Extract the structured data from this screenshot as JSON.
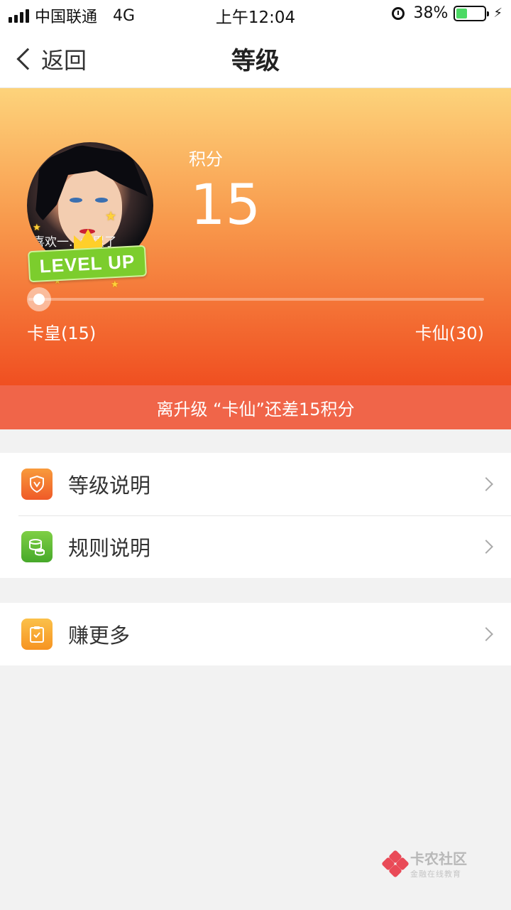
{
  "status_bar": {
    "carrier": "中国联通",
    "network": "4G",
    "time": "上午12:04",
    "battery_percent": "38%",
    "battery_level": 0.38,
    "icons": [
      "signal-icon",
      "alarm-icon",
      "battery-icon",
      "charging-icon"
    ]
  },
  "nav": {
    "back_label": "返回",
    "title": "等级"
  },
  "hero": {
    "points_label": "积分",
    "points_value": "15",
    "avatar_caption": "喜欢一...太累了",
    "badge_text": "LEVEL UP",
    "progress_fraction": 0.0,
    "current_level": "卡皇(15)",
    "next_level": "卡仙(30)",
    "colors": {
      "top": "#fdd37b",
      "bottom": "#f04f21"
    }
  },
  "hint": "离升级 “卡仙”还差15积分",
  "menu_group_1": [
    {
      "label": "等级说明",
      "icon": "shield-icon"
    },
    {
      "label": "规则说明",
      "icon": "coins-icon"
    }
  ],
  "menu_group_2": [
    {
      "label": "赚更多",
      "icon": "clipboard-check-icon"
    }
  ],
  "watermark": {
    "title": "卡农社区",
    "subtitle": "金融在线教育"
  }
}
